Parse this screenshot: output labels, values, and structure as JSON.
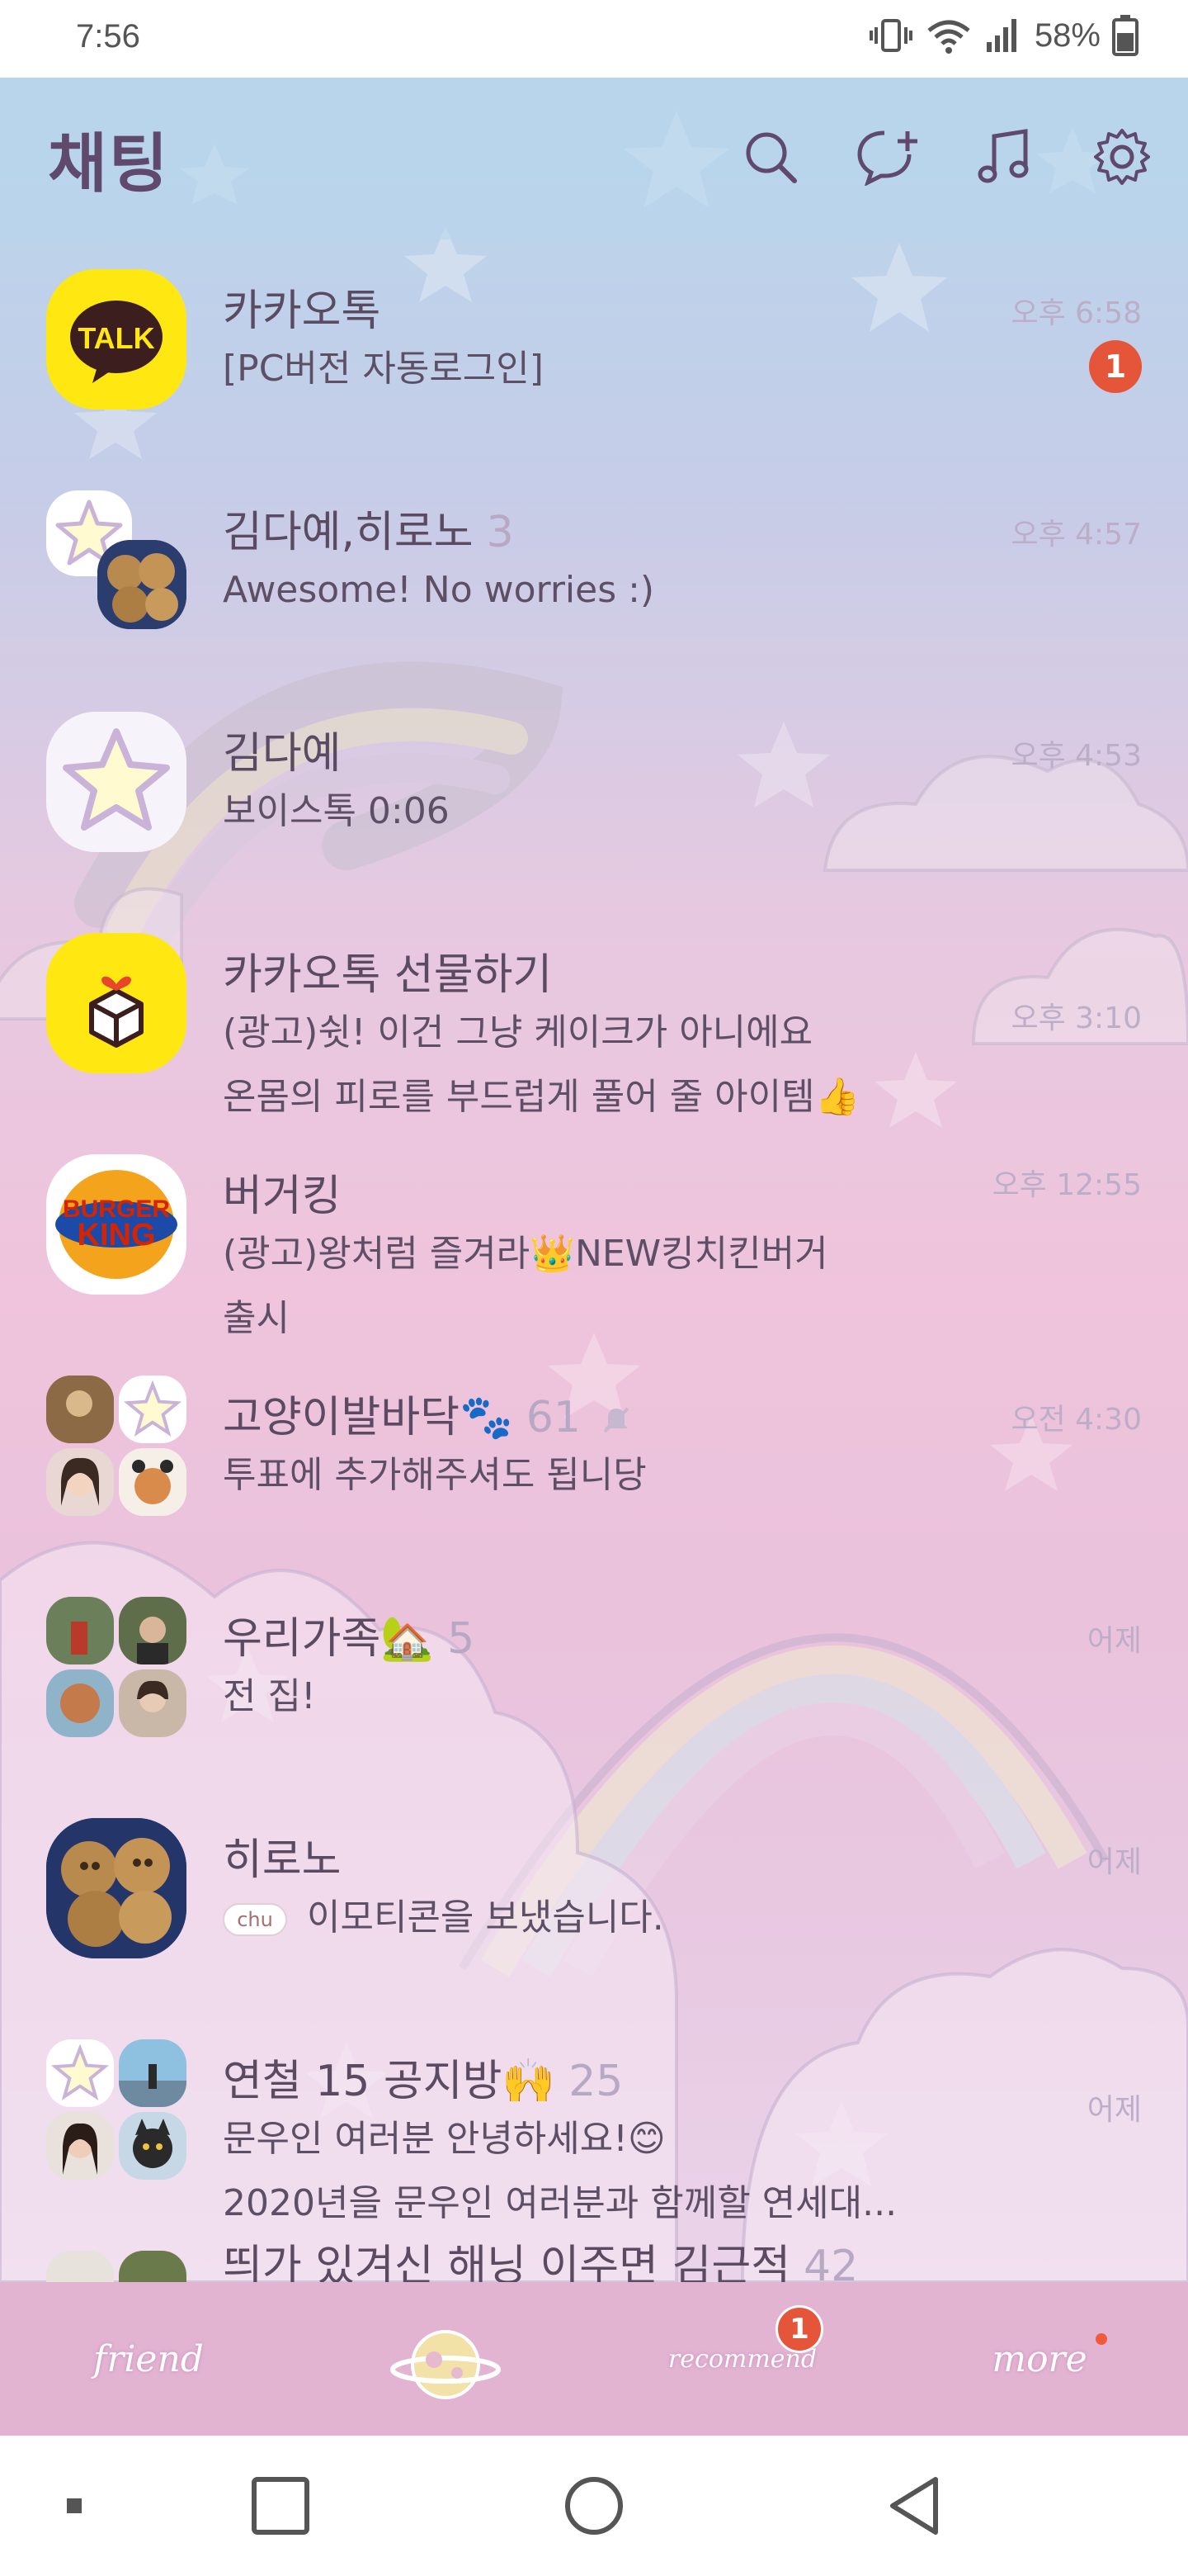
{
  "status_bar": {
    "time": "7:56",
    "battery": "58%",
    "icons": [
      "vibrate-icon",
      "wifi-icon",
      "signal-icon",
      "battery-icon"
    ]
  },
  "header": {
    "title": "채팅",
    "icons": [
      "search-icon",
      "new-chat-icon",
      "music-icon",
      "settings-icon"
    ]
  },
  "chats": [
    {
      "name": "카카오톡",
      "count": "",
      "message": "[PC버전 자동로그인]",
      "time": "오후 6:58",
      "unread": "1"
    },
    {
      "name": "김다예,히로노",
      "count": "3",
      "message": "Awesome! No worries :)",
      "time": "오후 4:57",
      "unread": ""
    },
    {
      "name": "김다예",
      "count": "",
      "message": "보이스톡 0:06",
      "time": "오후 4:53",
      "unread": ""
    },
    {
      "name": "카카오톡 선물하기",
      "count": "",
      "message": "(광고)쉿! 이건 그냥 케이크가 아니에요\n온몸의 피로를 부드럽게 풀어 줄 아이템👍",
      "time": "오후 3:10",
      "unread": ""
    },
    {
      "name": "버거킹",
      "count": "",
      "message": "(광고)왕처럼 즐겨라👑NEW킹치킨버거\n출시",
      "time": "오후 12:55",
      "unread": ""
    },
    {
      "name": "고양이발바닥🐾",
      "count": "61",
      "message": "투표에 추가해주셔도 됩니당",
      "time": "오전 4:30",
      "unread": ""
    },
    {
      "name": "우리가족🏡",
      "count": "5",
      "message": "전 집!",
      "time": "어제",
      "unread": ""
    },
    {
      "name": "히로노",
      "count": "",
      "message": "이모티콘을 보냈습니다.",
      "time": "어제",
      "unread": ""
    },
    {
      "name": "연철 15 공지방🙌",
      "count": "25",
      "message": "문우인 여러분 안녕하세요!😊\n2020년을 문우인 여러분과 함께할 연세대...",
      "time": "어제",
      "unread": ""
    },
    {
      "name": "띄가 있겨신 해닝 이주면 김근적",
      "count": "42",
      "message": "",
      "time": "",
      "unread": ""
    }
  ],
  "emoticon_label": "chu",
  "kakao_logo_text": "TALK",
  "burger_logo": [
    "BURGER",
    "KING"
  ],
  "tabs": {
    "friend": "friend",
    "chat_badge": "1",
    "recommend": "recommend",
    "more": "more"
  },
  "colors": {
    "accent_badge": "#e5553a",
    "title": "#5f4a6e",
    "tab_bar": "#e3b3d2"
  }
}
